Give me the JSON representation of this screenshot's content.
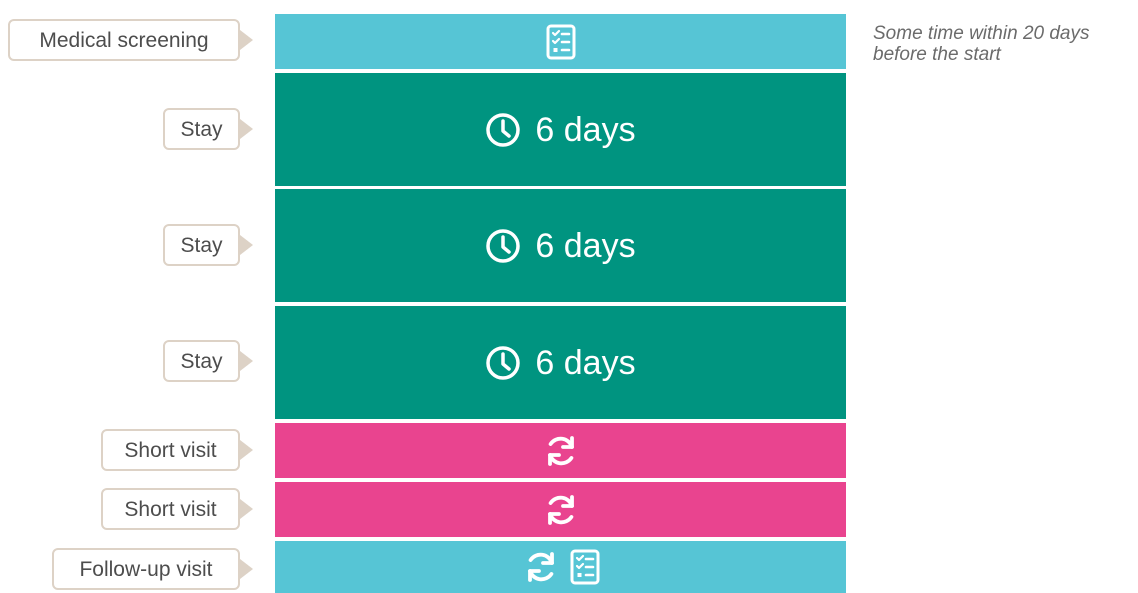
{
  "rows": [
    {
      "label": "Medical screening",
      "type": "screening",
      "icons": [
        "checklist-icon"
      ]
    },
    {
      "label": "Stay",
      "type": "stay",
      "icons": [
        "clock-icon"
      ],
      "text": "6 days"
    },
    {
      "label": "Stay",
      "type": "stay",
      "icons": [
        "clock-icon"
      ],
      "text": "6 days"
    },
    {
      "label": "Stay",
      "type": "stay",
      "icons": [
        "clock-icon"
      ],
      "text": "6 days"
    },
    {
      "label": "Short visit",
      "type": "short-visit",
      "icons": [
        "refresh-icon"
      ]
    },
    {
      "label": "Short visit",
      "type": "short-visit",
      "icons": [
        "refresh-icon"
      ]
    },
    {
      "label": "Follow-up visit",
      "type": "follow-up",
      "icons": [
        "refresh-icon",
        "checklist-icon"
      ]
    }
  ],
  "note": "Some time within 20 days before the start",
  "colors": {
    "screening": "#56c5d5",
    "stay": "#009480",
    "short_visit": "#e9448f",
    "follow_up": "#56c5d5",
    "label_border": "#ddd2c6"
  }
}
